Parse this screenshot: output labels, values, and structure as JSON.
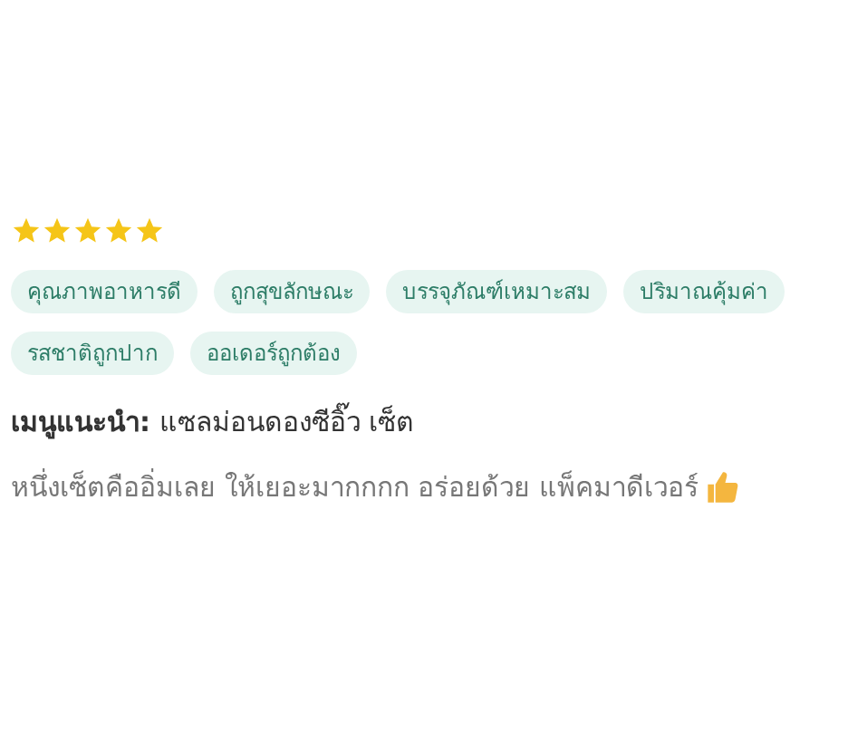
{
  "review": {
    "stars": 5,
    "tags": [
      "คุณภาพอาหารดี",
      "ถูกสุขลักษณะ",
      "บรรจุภัณฑ์เหมาะสม",
      "ปริมาณคุ้มค่า",
      "รสชาติถูกปาก",
      "ออเดอร์ถูกต้อง"
    ],
    "recommended": "**เมนูแนะนำ:** แซลม่อนดองซีอิ๊ว เซ็ต",
    "comment": "หนึ่งเซ็ตคืออิ่มเลย ให้เยอะมากกกก อร่อยด้วย แพ็คมาดีเวอร์"
  }
}
